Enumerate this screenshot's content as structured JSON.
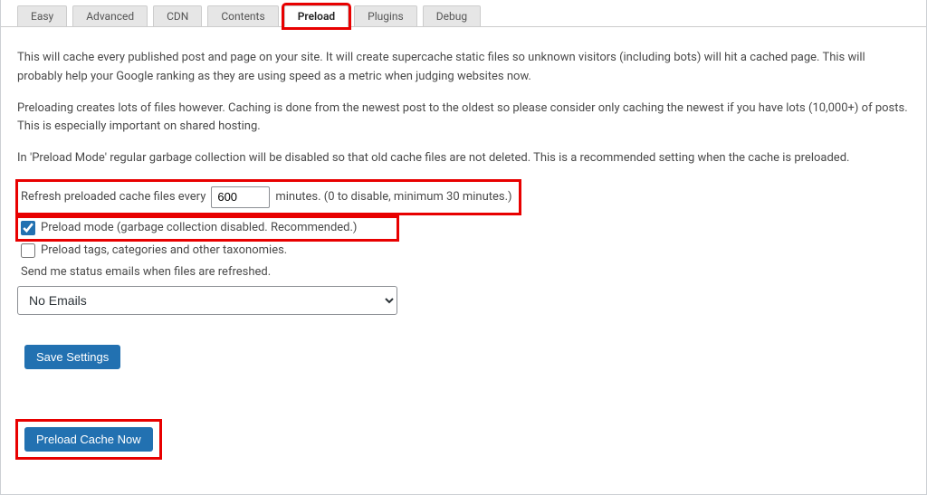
{
  "tabs": {
    "items": [
      {
        "label": "Easy"
      },
      {
        "label": "Advanced"
      },
      {
        "label": "CDN"
      },
      {
        "label": "Contents"
      },
      {
        "label": "Preload",
        "active": true
      },
      {
        "label": "Plugins"
      },
      {
        "label": "Debug"
      }
    ]
  },
  "intro": {
    "p1": "This will cache every published post and page on your site. It will create supercache static files so unknown visitors (including bots) will hit a cached page. This will probably help your Google ranking as they are using speed as a metric when judging websites now.",
    "p2": "Preloading creates lots of files however. Caching is done from the newest post to the oldest so please consider only caching the newest if you have lots (10,000+) of posts. This is especially important on shared hosting.",
    "p3": "In 'Preload Mode' regular garbage collection will be disabled so that old cache files are not deleted. This is a recommended setting when the cache is preloaded."
  },
  "refresh": {
    "prefix": "Refresh preloaded cache files every",
    "value": "600",
    "suffix": "minutes. (0 to disable, minimum 30 minutes.)"
  },
  "options": {
    "preload_mode": {
      "checked": true,
      "label": "Preload mode (garbage collection disabled. Recommended.)"
    },
    "preload_tax": {
      "checked": false,
      "label": "Preload tags, categories and other taxonomies."
    },
    "email_line": "Send me status emails when files are refreshed.",
    "email_select": {
      "selected": "No Emails",
      "options": [
        "No Emails"
      ]
    }
  },
  "buttons": {
    "save": "Save Settings",
    "preload_now": "Preload Cache Now"
  }
}
